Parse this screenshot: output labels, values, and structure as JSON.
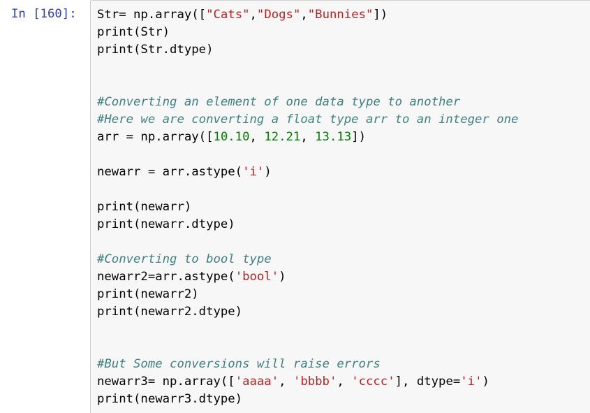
{
  "cell": {
    "prompt": "In [160]:",
    "lines": [
      [
        {
          "t": "Str= np.array([",
          "k": "plain"
        },
        {
          "t": "\"Cats\"",
          "k": "string"
        },
        {
          "t": ",",
          "k": "plain"
        },
        {
          "t": "\"Dogs\"",
          "k": "string"
        },
        {
          "t": ",",
          "k": "plain"
        },
        {
          "t": "\"Bunnies\"",
          "k": "string"
        },
        {
          "t": "])",
          "k": "plain"
        }
      ],
      [
        {
          "t": "print(Str)",
          "k": "plain"
        }
      ],
      [
        {
          "t": "print(Str.dtype)",
          "k": "plain"
        }
      ],
      [],
      [],
      [
        {
          "t": "#Converting an element of one data type to another",
          "k": "comment"
        }
      ],
      [
        {
          "t": "#Here we are converting a float type arr to an integer one",
          "k": "comment"
        }
      ],
      [
        {
          "t": "arr = np.array([",
          "k": "plain"
        },
        {
          "t": "10.10",
          "k": "number"
        },
        {
          "t": ", ",
          "k": "plain"
        },
        {
          "t": "12.21",
          "k": "number"
        },
        {
          "t": ", ",
          "k": "plain"
        },
        {
          "t": "13.13",
          "k": "number"
        },
        {
          "t": "])",
          "k": "plain"
        }
      ],
      [],
      [
        {
          "t": "newarr = arr.astype(",
          "k": "plain"
        },
        {
          "t": "'i'",
          "k": "string"
        },
        {
          "t": ")",
          "k": "plain"
        }
      ],
      [],
      [
        {
          "t": "print(newarr)",
          "k": "plain"
        }
      ],
      [
        {
          "t": "print(newarr.dtype)",
          "k": "plain"
        }
      ],
      [],
      [
        {
          "t": "#Converting to bool type",
          "k": "comment"
        }
      ],
      [
        {
          "t": "newarr2=arr.astype(",
          "k": "plain"
        },
        {
          "t": "'bool'",
          "k": "string"
        },
        {
          "t": ")",
          "k": "plain"
        }
      ],
      [
        {
          "t": "print(newarr2)",
          "k": "plain"
        }
      ],
      [
        {
          "t": "print(newarr2.dtype)",
          "k": "plain"
        }
      ],
      [],
      [],
      [
        {
          "t": "#But Some conversions will raise errors",
          "k": "comment"
        }
      ],
      [
        {
          "t": "newarr3= np.array([",
          "k": "plain"
        },
        {
          "t": "'aaaa'",
          "k": "string"
        },
        {
          "t": ", ",
          "k": "plain"
        },
        {
          "t": "'bbbb'",
          "k": "string"
        },
        {
          "t": ", ",
          "k": "plain"
        },
        {
          "t": "'cccc'",
          "k": "string"
        },
        {
          "t": "], dtype=",
          "k": "plain"
        },
        {
          "t": "'i'",
          "k": "string"
        },
        {
          "t": ")",
          "k": "plain"
        }
      ],
      [
        {
          "t": "print(newarr3.dtype)",
          "k": "plain"
        }
      ]
    ]
  },
  "colors": {
    "prompt": "#303f9f",
    "string": "#ba2121",
    "number": "#008000",
    "comment": "#408080",
    "editor_background": "#f7f7f7",
    "editor_border": "#cfcfcf"
  }
}
